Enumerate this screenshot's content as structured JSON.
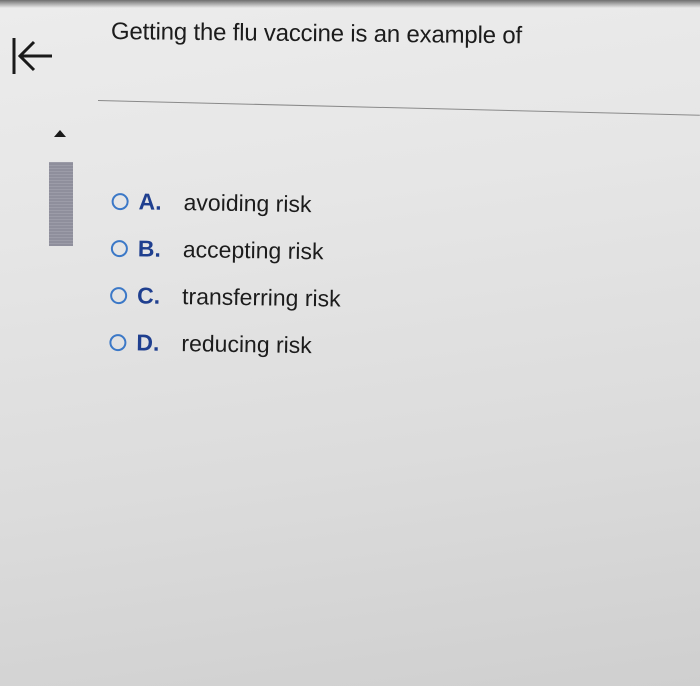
{
  "question": {
    "text": "Getting the flu vaccine is an example of"
  },
  "navigation": {
    "back_icon": "collapse-left-arrow-icon"
  },
  "options": [
    {
      "letter": "A.",
      "text": "avoiding risk"
    },
    {
      "letter": "B.",
      "text": "accepting risk"
    },
    {
      "letter": "C.",
      "text": "transferring risk"
    },
    {
      "letter": "D.",
      "text": "reducing risk"
    }
  ],
  "colors": {
    "radio_border": "#3b78c7",
    "letter": "#1f3f8f",
    "text": "#1c1c1c",
    "background": "#e6e6e6"
  }
}
